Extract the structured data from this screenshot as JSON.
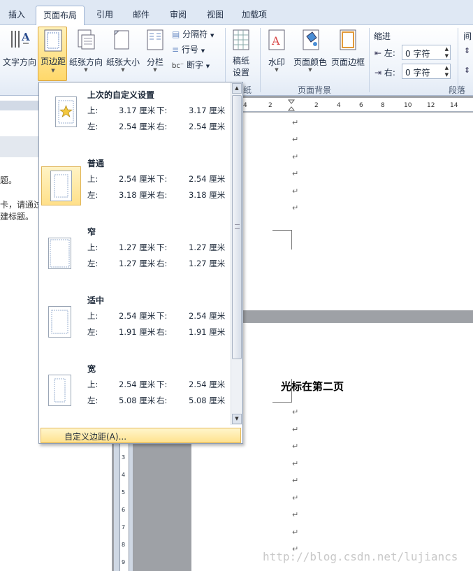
{
  "tabs": [
    "插入",
    "页面布局",
    "引用",
    "邮件",
    "审阅",
    "视图",
    "加载项"
  ],
  "ribbon": {
    "text_direction": "文字方向",
    "margins": "页边距",
    "orientation": "纸张方向",
    "size": "纸张大小",
    "columns": "分栏",
    "breaks": "分隔符",
    "line_numbers": "行号",
    "hyphenation": "断字",
    "manuscript": "稿纸",
    "manuscript2": "设置",
    "manuscript_group": "纸",
    "watermark": "水印",
    "page_color": "页面颜色",
    "page_borders": "页面边框",
    "page_background_group": "页面背景",
    "indent": "缩进",
    "indent_left_label": "左:",
    "indent_left_value": "0 字符",
    "indent_right_label": "右:",
    "indent_right_value": "0 字符",
    "spacing": "间",
    "paragraph_group": "段落",
    "page_setup_label_partial": "置"
  },
  "left_pane": {
    "line1": "题。",
    "line2": "卡，请通过",
    "line3": "建标题。"
  },
  "ruler_marks": [
    "4",
    "2",
    "2",
    "4",
    "6",
    "8",
    "10",
    "12",
    "14"
  ],
  "vruler_marks": [
    "3",
    "4",
    "5",
    "6",
    "7",
    "8",
    "9"
  ],
  "margins_menu": {
    "options": [
      {
        "title": "上次的自定义设置",
        "top_label": "上:",
        "top": "3.17 厘米",
        "bottom_label": "下:",
        "bottom": "3.17 厘米",
        "left_label": "左:",
        "left": "2.54 厘米",
        "right_label": "右:",
        "right": "2.54 厘米"
      },
      {
        "title": "普通",
        "top_label": "上:",
        "top": "2.54 厘米",
        "bottom_label": "下:",
        "bottom": "2.54 厘米",
        "left_label": "左:",
        "left": "3.18 厘米",
        "right_label": "右:",
        "right": "3.18 厘米"
      },
      {
        "title": "窄",
        "top_label": "上:",
        "top": "1.27 厘米",
        "bottom_label": "下:",
        "bottom": "1.27 厘米",
        "left_label": "左:",
        "left": "1.27 厘米",
        "right_label": "右:",
        "right": "1.27 厘米"
      },
      {
        "title": "适中",
        "top_label": "上:",
        "top": "2.54 厘米",
        "bottom_label": "下:",
        "bottom": "2.54 厘米",
        "left_label": "左:",
        "left": "1.91 厘米",
        "right_label": "右:",
        "right": "1.91 厘米"
      },
      {
        "title": "宽",
        "top_label": "上:",
        "top": "2.54 厘米",
        "bottom_label": "下:",
        "bottom": "2.54 厘米",
        "left_label": "左:",
        "left": "5.08 厘米",
        "right_label": "右:",
        "right": "5.08 厘米"
      }
    ],
    "custom_label": "自定义边距(A)..."
  },
  "document": {
    "page2_text": "光标在第二页",
    "para_mark": "↵"
  },
  "watermark": "http://blog.csdn.net/lujiancs"
}
